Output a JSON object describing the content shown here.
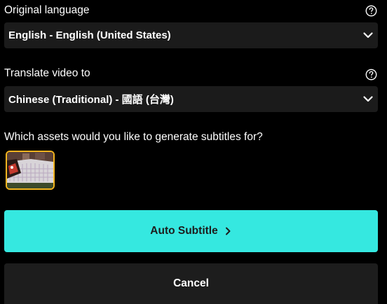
{
  "original_language": {
    "label": "Original language",
    "value": "English - English (United States)",
    "help_icon": "question-circle-icon"
  },
  "translate_to": {
    "label": "Translate video to",
    "value": "Chinese (Traditional) - 國語 (台灣)",
    "help_icon": "question-circle-icon"
  },
  "assets": {
    "prompt": "Which assets would you like to generate subtitles for?",
    "selected_border_color": "#f2b41e"
  },
  "actions": {
    "auto_subtitle_label": "Auto Subtitle",
    "cancel_label": "Cancel",
    "accent_color": "#35e8e0"
  }
}
